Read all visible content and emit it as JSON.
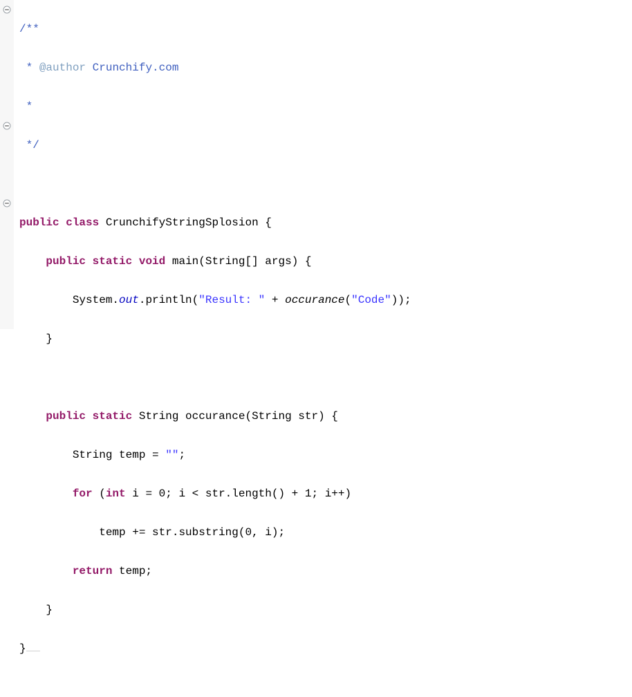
{
  "code": {
    "l1_open": "/**",
    "l2_star": " * ",
    "l2_tag": "@author",
    "l2_rest": " Crunchify.com",
    "l3": " *",
    "l4": " */",
    "l6_k1": "public",
    "l6_k2": "class",
    "l6_name": "CrunchifyStringSplosion",
    "l6_brace": " {",
    "l7_k1": "public",
    "l7_k2": "static",
    "l7_k3": "void",
    "l7_name": "main",
    "l7_args": "(String[] args) {",
    "l8_pre": "System.",
    "l8_out": "out",
    "l8_dot": ".println(",
    "l8_str": "\"Result: \"",
    "l8_plus": " + ",
    "l8_occ": "occurance",
    "l8_open": "(",
    "l8_arg": "\"Code\"",
    "l8_end": "));",
    "l9": "}",
    "l11_k1": "public",
    "l11_k2": "static",
    "l11_type": "String",
    "l11_name": " occurance(String str) {",
    "l12_pre": "String temp = ",
    "l12_str": "\"\"",
    "l12_end": ";",
    "l13_k1": "for",
    "l13_open": " (",
    "l13_k2": "int",
    "l13_rest": " i = 0; i < str.length() + 1; i++)",
    "l14": "temp += str.substring(0, i);",
    "l15_k": "return",
    "l15_rest": " temp;",
    "l16": "}",
    "l17": "}"
  },
  "icons": {
    "fold": "fold-minus"
  }
}
